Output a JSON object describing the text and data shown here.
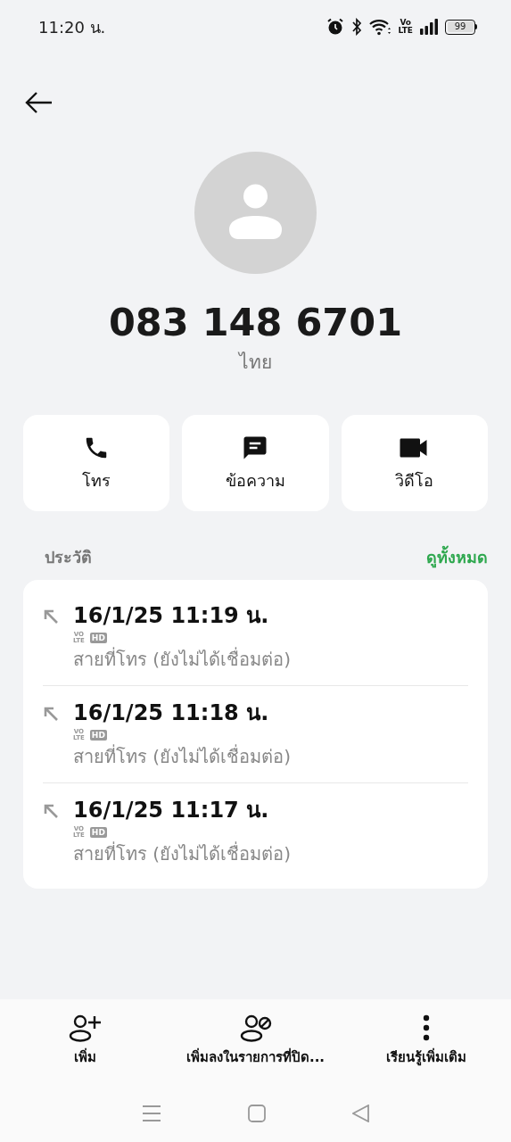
{
  "status_bar": {
    "time": "11:20 น.",
    "volte": [
      "Vo",
      "LTE"
    ],
    "battery": "99"
  },
  "contact": {
    "number": "083 148 6701",
    "country": "ไทย"
  },
  "actions": [
    {
      "kind": "call",
      "label": "โทร"
    },
    {
      "kind": "message",
      "label": "ข้อความ"
    },
    {
      "kind": "video",
      "label": "วิดีโอ"
    }
  ],
  "history": {
    "title": "ประวัติ",
    "see_all": "ดูทั้งหมด",
    "rows": [
      {
        "time": "16/1/25 11:19 น.",
        "volte": [
          "VO",
          "LTE"
        ],
        "hd": "HD",
        "status": "สายที่โทร (ยังไม่ได้เชื่อมต่อ)"
      },
      {
        "time": "16/1/25 11:18 น.",
        "volte": [
          "VO",
          "LTE"
        ],
        "hd": "HD",
        "status": "สายที่โทร (ยังไม่ได้เชื่อมต่อ)"
      },
      {
        "time": "16/1/25 11:17 น.",
        "volte": [
          "VO",
          "LTE"
        ],
        "hd": "HD",
        "status": "สายที่โทร (ยังไม่ได้เชื่อมต่อ)"
      }
    ]
  },
  "bottom_actions": [
    {
      "kind": "add",
      "label": "เพิ่ม"
    },
    {
      "kind": "block",
      "label": "เพิ่มลงในรายการที่ปิด..."
    },
    {
      "kind": "more",
      "label": "เรียนรู้เพิ่มเติม"
    }
  ]
}
